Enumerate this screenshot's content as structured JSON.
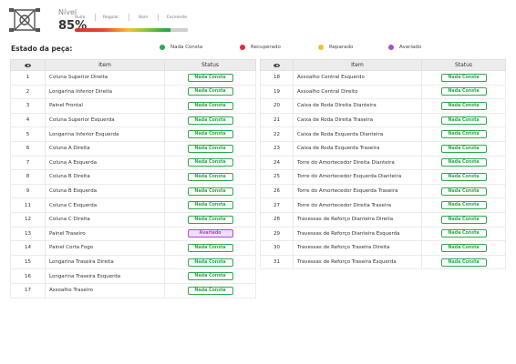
{
  "header": {
    "nivel_label": "Nível",
    "nivel_value": "85%",
    "scale": [
      "Ruim",
      "Regular",
      "Bom",
      "Excelente"
    ],
    "level_fraction": 0.85
  },
  "legend": {
    "title": "Estado da peça:",
    "items": [
      {
        "label": "Nada Consta",
        "color": "#2ea84c"
      },
      {
        "label": "Recuperado",
        "color": "#e5263f"
      },
      {
        "label": "Reparado",
        "color": "#f6c02f"
      },
      {
        "label": "Avariado",
        "color": "#a84cd1"
      }
    ]
  },
  "status_styles": {
    "Nada Consta": {
      "bg": "#ffffff",
      "border": "#2ea84c",
      "color": "#2ea84c"
    },
    "Avariado": {
      "bg": "#f1ddf8",
      "border": "#a84cd1",
      "color": "#a84cd1"
    }
  },
  "columns": {
    "item": "Item",
    "status": "Status"
  },
  "left_rows": [
    {
      "num": "1",
      "item": "Coluna Superior Direita",
      "status": "Nada Consta"
    },
    {
      "num": "2",
      "item": "Longarina Inferior Direita",
      "status": "Nada Consta"
    },
    {
      "num": "3",
      "item": "Painel Frontal",
      "status": "Nada Consta"
    },
    {
      "num": "4",
      "item": "Coluna Superior Esquerda",
      "status": "Nada Consta"
    },
    {
      "num": "5",
      "item": "Longarina Inferior Esquerda",
      "status": "Nada Consta"
    },
    {
      "num": "6",
      "item": "Coluna A Direita",
      "status": "Nada Consta"
    },
    {
      "num": "7",
      "item": "Coluna A Esquerda",
      "status": "Nada Consta"
    },
    {
      "num": "8",
      "item": "Coluna B Direita",
      "status": "Nada Consta"
    },
    {
      "num": "9",
      "item": "Coluna B Esquerda",
      "status": "Nada Consta"
    },
    {
      "num": "11",
      "item": "Coluna C Esquerda",
      "status": "Nada Consta"
    },
    {
      "num": "12",
      "item": "Coluna C Direita",
      "status": "Nada Consta"
    },
    {
      "num": "13",
      "item": "Painel Traseiro",
      "status": "Avariado"
    },
    {
      "num": "14",
      "item": "Painel Corta Fogo",
      "status": "Nada Consta"
    },
    {
      "num": "15",
      "item": "Longarina Traseira Direita",
      "status": "Nada Consta"
    },
    {
      "num": "16",
      "item": "Longarina Traseira Esquerda",
      "status": "Nada Consta"
    },
    {
      "num": "17",
      "item": "Assoalho Traseiro",
      "status": "Nada Consta"
    }
  ],
  "right_rows": [
    {
      "num": "18",
      "item": "Assoalho Central Esquerdo",
      "status": "Nada Consta"
    },
    {
      "num": "19",
      "item": "Assoalho Central Direito",
      "status": "Nada Consta"
    },
    {
      "num": "20",
      "item": "Caixa de Roda Direita Dianteira",
      "status": "Nada Consta"
    },
    {
      "num": "21",
      "item": "Caixa de Roda Direita Traseira",
      "status": "Nada Consta"
    },
    {
      "num": "22",
      "item": "Caixa de Roda Esquerda Dianteira",
      "status": "Nada Consta"
    },
    {
      "num": "23",
      "item": "Caixa de Roda Esquerda Traseira",
      "status": "Nada Consta"
    },
    {
      "num": "24",
      "item": "Torre do Amortecedor Direita Dianteira",
      "status": "Nada Consta"
    },
    {
      "num": "25",
      "item": "Torre do Amortecedor Esquerda Dianteira",
      "status": "Nada Consta"
    },
    {
      "num": "26",
      "item": "Torre do Amortecedor Esquerda Traseira",
      "status": "Nada Consta"
    },
    {
      "num": "27",
      "item": "Torre do Amortecedor Direita Traseira",
      "status": "Nada Consta"
    },
    {
      "num": "28",
      "item": "Travessas de Reforço Dianteira Direita",
      "status": "Nada Consta"
    },
    {
      "num": "29",
      "item": "Travessas de Reforço Dianteira Esquerda",
      "status": "Nada Consta"
    },
    {
      "num": "30",
      "item": "Travessas de Reforço Traseira Direita",
      "status": "Nada Consta"
    },
    {
      "num": "31",
      "item": "Travessas de Reforço Traseira Esquerda",
      "status": "Nada Consta"
    }
  ]
}
